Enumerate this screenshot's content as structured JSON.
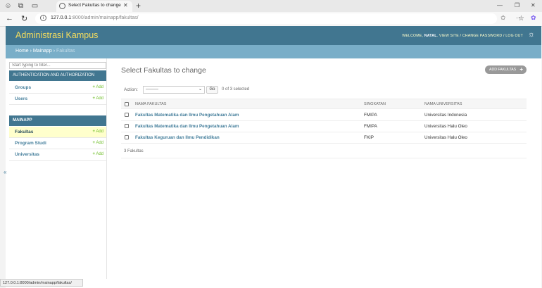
{
  "browser": {
    "tab_title": "Select Fakultas to change | Sistem",
    "url_host": "127.0.0.1",
    "url_rest": ":8000/admin/mainapp/fakultas/",
    "status_url": "127.0.0.1:8000/admin/mainapp/fakultas/"
  },
  "header": {
    "brand": "Administrasi Kampus",
    "welcome": "WELCOME,",
    "user": "NATAL",
    "tools": ". VIEW SITE / CHANGE PASSWORD / LOG OUT"
  },
  "breadcrumb": {
    "home": "Home",
    "app": "Mainapp",
    "current": "Fakultas",
    "sep": " › "
  },
  "sidebar": {
    "filter_placeholder": "Start typing to filter...",
    "modules": [
      {
        "caption": "Authentication and Authorization",
        "items": [
          {
            "label": "Groups",
            "add": "Add"
          },
          {
            "label": "Users",
            "add": "Add"
          }
        ]
      },
      {
        "caption": "Mainapp",
        "items": [
          {
            "label": "Fakultas",
            "add": "Add",
            "selected": true
          },
          {
            "label": "Program Studi",
            "add": "Add"
          },
          {
            "label": "Universitas",
            "add": "Add"
          }
        ]
      }
    ],
    "collapse_icon": "«"
  },
  "content": {
    "title": "Select Fakultas to change",
    "add_button": "ADD FAKULTAS",
    "action_label": "Action:",
    "action_value": "---------",
    "go_label": "Go",
    "counter": "0 of 3 selected",
    "columns": [
      "Nama Fakultas",
      "Singkatan",
      "Nama Universitas"
    ],
    "rows": [
      [
        "Fakultas Matematika dan Ilmu Pengetahuan Alam",
        "FMIPA",
        "Universitas Indonesia"
      ],
      [
        "Fakultas Matematika dan Ilmu Pengetahuan Alam",
        "FMIPA",
        "Universitas Halu Oleo"
      ],
      [
        "Fakultas Keguruan dan Ilmu Pendidikan",
        "FKIP",
        "Universitas Halu Oleo"
      ]
    ],
    "paginator": "3 Fakultas"
  },
  "colors": {
    "header": "#417690",
    "breadcrumb": "#79aec8",
    "brand": "#f5dd5d",
    "link": "#447e9b",
    "add": "#70bf2b",
    "selected_row": "#ffffcc"
  }
}
